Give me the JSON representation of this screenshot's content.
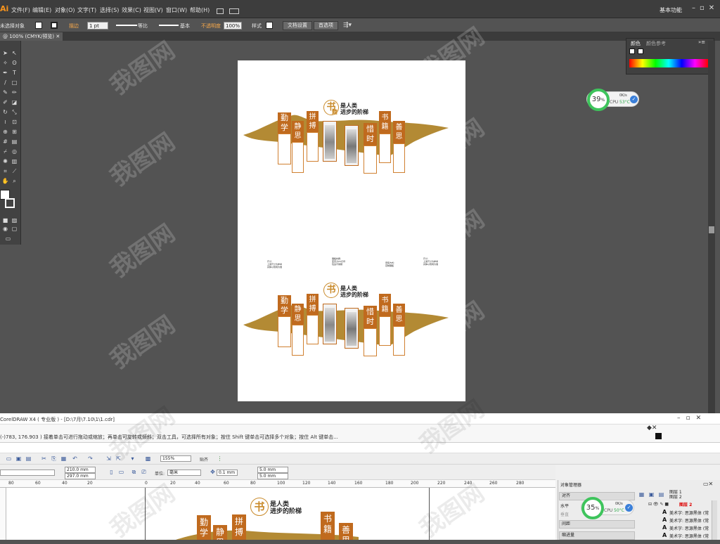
{
  "illustrator": {
    "logo": "Ai",
    "menus": [
      "文件(F)",
      "编辑(E)",
      "对象(O)",
      "文字(T)",
      "选择(S)",
      "效果(C)",
      "视图(V)",
      "窗口(W)",
      "帮助(H)"
    ],
    "workspace": "基本功能",
    "control_bar": {
      "selection_status": "未选择对象",
      "stroke_label": "描边",
      "stroke_weight": "1 pt",
      "brush_label": "等比",
      "style_label": "基本",
      "opacity_label": "不透明度",
      "opacity_value": "100%",
      "style_field_label": "样式",
      "doc_settings_button": "文档设置",
      "preferences_button": "首选项"
    },
    "doc_tab": "@ 100% (CMYK/预览)",
    "color_panel": {
      "tabs": [
        "颜色",
        "颜色参考"
      ]
    }
  },
  "cpu_widget_top": {
    "percent": "39",
    "percent_unit": "%",
    "speed": "0K/s",
    "label": "CPU",
    "temp": "53°C"
  },
  "cpu_widget_bottom": {
    "percent": "35",
    "percent_unit": "%",
    "speed": "0K/s",
    "label": "CPU",
    "temp": "50°C"
  },
  "artwork": {
    "title_char": "书",
    "title_char2": "籍",
    "title_line1": "是人类",
    "title_line2": "进步的阶梯",
    "boards": [
      "勤学",
      "静思",
      "拼搏",
      "惜时",
      "书籍",
      "善思"
    ],
    "small_notes": [
      "尺寸：",
      "上述尺寸为参考",
      "具体以现场为准",
      "展板材质：",
      "亚克力UV打印",
      "包边不锈钢",
      "安装方式：",
      "定制展板",
      "尺寸：",
      "上述尺寸为参考",
      "具体以现场为准",
      "展板材质：",
      "亚克力UV打印",
      "包边不锈钢"
    ]
  },
  "coreldraw": {
    "title": "CorelDRAW X4 ( 专业版 ) - [D:\\7月\\7.10\\1\\1.cdr]",
    "status": "(-)783, 176.903 )   接着单击可进行拖动或缩放；再单击可旋转或倾斜；双击工具，可选择所有对象；按住 Shift 键单击可选择多个对象；按住 Alt 键单击...",
    "zoom": "155%",
    "snap_label": "贴齐",
    "width": "210.0 mm",
    "height": "297.0 mm",
    "units_label": "单位:",
    "units_value": "毫米",
    "nudge": "0.1 mm",
    "dup_x": "5.0 mm",
    "dup_y": "5.0 mm",
    "ruler_numbers": [
      "80",
      "60",
      "40",
      "20",
      "0",
      "20",
      "40",
      "60",
      "80",
      "100",
      "120",
      "140",
      "160",
      "180",
      "200",
      "220",
      "240",
      "260",
      "280"
    ],
    "object_manager": {
      "title": "对象管理器",
      "align_label": "对齐",
      "horizontal_label": "水平",
      "vertical_label": "垂直",
      "spacing_label": "间距",
      "scale_label": "缩进量",
      "layers": [
        "图层 1",
        "图层 2"
      ],
      "active_layer": "图层 2",
      "items": [
        "美术字: 思源黑体 (常",
        "美术字: 思源黑体 (常",
        "美术字: 思源黑体 (常",
        "美术字: 思源黑体 (常"
      ]
    }
  },
  "watermark": "我图网"
}
